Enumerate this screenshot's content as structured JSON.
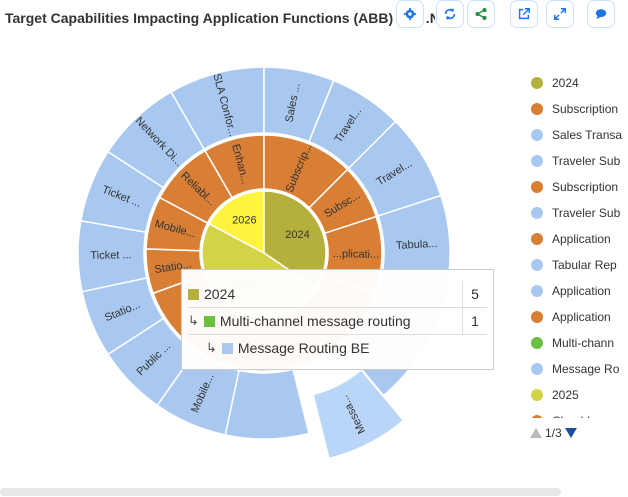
{
  "title": "Target Capabilities Impacting Application Functions (ABB) - by .N  ata",
  "toolbar": [
    {
      "name": "settings-gear-icon",
      "color": "#1a73e8"
    },
    {
      "name": "refresh-icon",
      "color": "#1a73e8"
    },
    {
      "name": "share-icon",
      "color": "#1e8e3e"
    },
    {
      "name": "open-external-icon",
      "color": "#1a73e8"
    },
    {
      "name": "expand-icon",
      "color": "#1a73e8"
    },
    {
      "name": "comment-icon",
      "color": "#1a73e8"
    }
  ],
  "chart_data": {
    "type": "sunburst",
    "colors": {
      "year_2024": "#b5b03c",
      "year_2025": "#d4d247",
      "year_2026": "#fef33e",
      "orange": "#d97e35",
      "blue": "#a8c8f0",
      "highlight": "#b9d5f7"
    },
    "center": {
      "label": ""
    },
    "rings": {
      "inner": [
        {
          "label": "2026",
          "color": "#fef33e"
        },
        {
          "label": "2024",
          "color": "#b5b03c"
        },
        {
          "label": "2025",
          "color": "#d4d247"
        }
      ],
      "middle": [
        {
          "label": "Enhan...",
          "color": "#d97e35"
        },
        {
          "label": "Subscrip...",
          "color": "#d97e35"
        },
        {
          "label": "Subsc...",
          "color": "#d97e35"
        },
        {
          "label": "...plicati...",
          "color": "#d97e35"
        },
        {
          "label": "Statio...",
          "color": "#d97e35"
        },
        {
          "label": "Mobile...",
          "color": "#d97e35"
        },
        {
          "label": "Reliabl...",
          "color": "#d97e35"
        }
      ],
      "outer": [
        {
          "label": "SLA Confor...",
          "color": "#a8c8f0"
        },
        {
          "label": "Sales ...",
          "color": "#a8c8f0"
        },
        {
          "label": "Travel...",
          "color": "#a8c8f0"
        },
        {
          "label": "Travel...",
          "color": "#a8c8f0"
        },
        {
          "label": "Tabula...",
          "color": "#a8c8f0"
        },
        {
          "label": "Messa...",
          "color": "#b9d5f7"
        },
        {
          "label": "Mobile...",
          "color": "#a8c8f0"
        },
        {
          "label": "Public ...",
          "color": "#a8c8f0"
        },
        {
          "label": "Statio...",
          "color": "#a8c8f0"
        },
        {
          "label": "Ticket ...",
          "color": "#a8c8f0"
        },
        {
          "label": "Ticket ...",
          "color": "#a8c8f0"
        },
        {
          "label": "Network Di...",
          "color": "#a8c8f0"
        }
      ]
    },
    "legend": [
      {
        "label": "2024",
        "color": "#b5b03c"
      },
      {
        "label": "Subscription",
        "color": "#d97e35"
      },
      {
        "label": "Sales Transa",
        "color": "#a8c8f0"
      },
      {
        "label": "Traveler Sub",
        "color": "#a8c8f0"
      },
      {
        "label": "Subscription",
        "color": "#d97e35"
      },
      {
        "label": "Traveler Sub",
        "color": "#a8c8f0"
      },
      {
        "label": "Application",
        "color": "#d97e35"
      },
      {
        "label": "Tabular Rep",
        "color": "#a8c8f0"
      },
      {
        "label": "Application",
        "color": "#a8c8f0"
      },
      {
        "label": "Application",
        "color": "#d97e35"
      },
      {
        "label": "Multi-chann",
        "color": "#6cbf3f"
      },
      {
        "label": "Message Ro",
        "color": "#a8c8f0"
      },
      {
        "label": "2025",
        "color": "#d4d247"
      },
      {
        "label": "Cloud-base",
        "color": "#d97e35"
      }
    ],
    "pager": "1/3",
    "tooltip": {
      "rows": [
        {
          "label": "2024",
          "count": "5",
          "color": "#b5b03c"
        },
        {
          "label": "Multi-channel message routing",
          "count": "1",
          "color": "#6cbf3f"
        },
        {
          "label": "Message Routing BE",
          "count": "",
          "color": "#a8c8f0"
        }
      ]
    }
  }
}
